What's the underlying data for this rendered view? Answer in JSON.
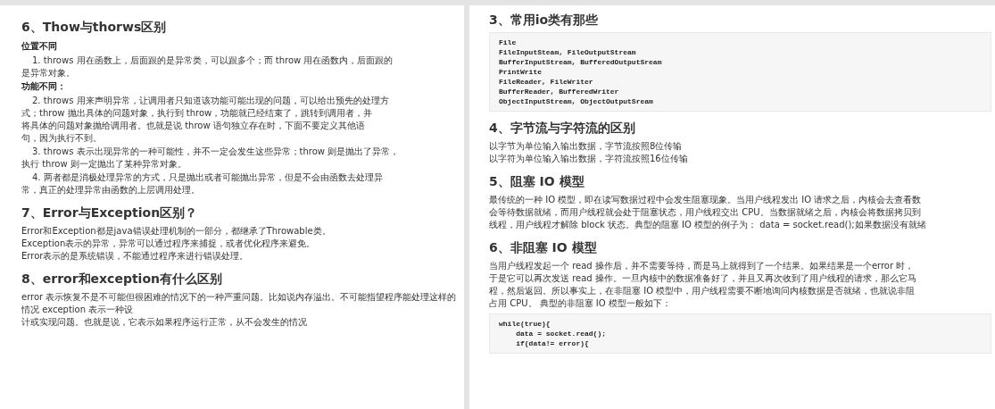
{
  "pages": [
    {
      "sections": [
        {
          "heading": "6、Thow与thorws区别",
          "blocks": [
            {
              "kind": "label",
              "text": "位置不同"
            },
            {
              "kind": "item",
              "text": "1. throws 用在函数上，后面跟的是异常类，可以跟多个；而 throw 用在函数内，后面跟的"
            },
            {
              "kind": "para",
              "text": "是异常对象。"
            },
            {
              "kind": "label",
              "text": "功能不同："
            },
            {
              "kind": "item",
              "text": "2. throws 用来声明异常，让调用者只知道该功能可能出现的问题，可以给出预先的处理方"
            },
            {
              "kind": "para",
              "text": "式；throw 抛出具体的问题对象，执行到 throw，功能就已经结束了，跳转到调用者，并"
            },
            {
              "kind": "para",
              "text": "将具体的问题对象抛给调用者。也就是说 throw 语句独立存在时，下面不要定义其他语"
            },
            {
              "kind": "para",
              "text": "句，因为执行不到。"
            },
            {
              "kind": "item",
              "text": "3. throws 表示出现异常的一种可能性，并不一定会发生这些异常；throw 则是抛出了异常，"
            },
            {
              "kind": "para",
              "text": "执行 throw 则一定抛出了某种异常对象。"
            },
            {
              "kind": "item",
              "text": "4. 两者都是消极处理异常的方式，只是抛出或者可能抛出异常，但是不会由函数去处理异"
            },
            {
              "kind": "para",
              "text": "常，真正的处理异常由函数的上层调用处理。"
            }
          ]
        },
        {
          "heading": "7、Error与Exception区别？",
          "blocks": [
            {
              "kind": "para",
              "text": "Error和Exception都是java错误处理机制的一部分，都继承了Throwable类。"
            },
            {
              "kind": "para",
              "text": "Exception表示的异常，异常可以通过程序来捕捉，或者优化程序来避免。"
            },
            {
              "kind": "para",
              "text": "Error表示的是系统错误，不能通过程序来进行错误处理。"
            }
          ]
        },
        {
          "heading": "8、error和exception有什么区别",
          "blocks": [
            {
              "kind": "para",
              "text": "error 表示恢复不是不可能但很困难的情况下的一种严重问题。比如说内存溢出。不可能指望程序能处理这样的情况 exception 表示一种设"
            },
            {
              "kind": "para",
              "text": "计或实现问题。也就是说，它表示如果程序运行正常，从不会发生的情况"
            }
          ]
        }
      ]
    },
    {
      "sections": [
        {
          "heading": "3、常用io类有那些",
          "blocks": [
            {
              "kind": "code",
              "lines": [
                "File",
                "FileInputSteam, FileOutputStream",
                "BufferInputStream, BufferedOutputSream",
                "PrintWrite",
                "FileReader, FileWriter",
                "BufferReader, BufferedWriter",
                "ObjectInputStream, ObjectOutputSream"
              ]
            }
          ]
        },
        {
          "heading": "4、字节流与字符流的区别",
          "blocks": [
            {
              "kind": "para",
              "text": "以字节为单位输入输出数据，字节流按照8位传输"
            },
            {
              "kind": "para",
              "text": "以字符为单位输入输出数据，字符流按照16位传输"
            }
          ]
        },
        {
          "heading": "5、阻塞 IO 模型",
          "blocks": [
            {
              "kind": "para",
              "text": "最传统的一种 IO 模型，即在读写数据过程中会发生阻塞现象。当用户线程发出 IO 请求之后，内核会去查看数"
            },
            {
              "kind": "para",
              "text": "会等待数据就绪，而用户线程就会处于阻塞状态，用户线程交出 CPU。当数据就绪之后，内核会将数据拷贝到"
            },
            {
              "kind": "para",
              "text": "线程，用户线程才解除 block 状态。典型的阻塞 IO 模型的例子为： data = socket.read();如果数据没有就绪"
            }
          ]
        },
        {
          "heading": "6、非阻塞 IO 模型",
          "blocks": [
            {
              "kind": "para",
              "text": "当用户线程发起一个 read 操作后，并不需要等待，而是马上就得到了一个结果。如果结果是一个error 时，"
            },
            {
              "kind": "para",
              "text": "于是它可以再次发送 read 操作。一旦内核中的数据准备好了，并且又再次收到了用户线程的请求，那么它马"
            },
            {
              "kind": "para",
              "text": "程，然后返回。所以事实上，在非阻塞 IO 模型中，用户线程需要不断地询问内核数据是否就绪，也就说非阻"
            },
            {
              "kind": "para",
              "text": "占用 CPU。 典型的非阻塞 IO 模型一般如下："
            },
            {
              "kind": "code",
              "lines": [
                "while(true){",
                "    data = socket.read();",
                "    if(data!= error){"
              ]
            }
          ]
        }
      ]
    }
  ]
}
